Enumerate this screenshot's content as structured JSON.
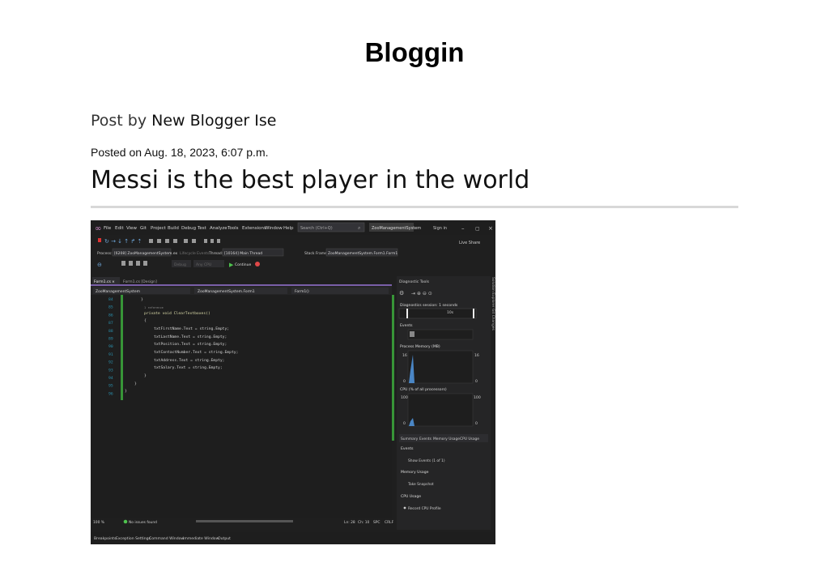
{
  "site": {
    "title": "Bloggin"
  },
  "post": {
    "byline_prefix": "Post by",
    "author": "New Blogger Ise",
    "posted": "Posted on Aug. 18, 2023, 6:07 p.m.",
    "title": "Messi is the best player in the world"
  },
  "screenshot": {
    "menu": [
      "File",
      "Edit",
      "View",
      "Git",
      "Project",
      "Build",
      "Debug",
      "Test",
      "Analyze",
      "Tools",
      "Extensions",
      "Window",
      "Help"
    ],
    "search_placeholder": "Search (Ctrl+Q)",
    "solution_badge": "ZooManagementSystem",
    "sign_in": "Sign in",
    "live_share": "Live Share",
    "process_label": "Process:",
    "process_value": "[6208] ZooManagementSystem.ex",
    "lifecycle_label": "Lifecycle Events",
    "thread_label": "Thread:",
    "thread_value": "[10164] Main Thread",
    "stack_label": "Stack Frame:",
    "stack_value": "ZooManagementSystem.Form1.Form1",
    "continue_label": "Continue",
    "config_value": "Debug",
    "platform_value": "Any CPU",
    "tabs": [
      "Form1.cs",
      "Form1.cs [Design]"
    ],
    "nav_project": "ZooManagementSystem",
    "nav_class": "ZooManagementSystem.Form1",
    "nav_member": "Form1()",
    "line_numbers": [
      "84",
      "85",
      "86",
      "87",
      "88",
      "89",
      "90",
      "91",
      "92",
      "93",
      "94",
      "95",
      "96"
    ],
    "code_ref": "1 reference",
    "code_lines": [
      "}",
      "private void ClearTextboxes()",
      "{",
      "txtFirstName.Text = string.Empty;",
      "txtLastName.Text = string.Empty;",
      "txtPosition.Text = string.Empty;",
      "txtContactNumber.Text = string.Empty;",
      "txtAddress.Text = string.Empty;",
      "txtSalary.Text = string.Empty;",
      "}",
      "}",
      "}"
    ],
    "diag_title": "Diagnostic Tools",
    "diag_session": "Diagnostics session: 1 seconds",
    "diag_10s": "10s",
    "events_label": "Events",
    "memory_label": "Process Memory (MB)",
    "memory_max": "16",
    "memory_min": "0",
    "cpu_label": "CPU (% of all processors)",
    "cpu_max": "100",
    "cpu_min": "0",
    "diag_tabs": [
      "Summary",
      "Events",
      "Memory Usage",
      "CPU Usage"
    ],
    "summary_events": "Events",
    "show_events": "Show Events (1 of 1)",
    "summary_memory": "Memory Usage",
    "take_snapshot": "Take Snapshot",
    "summary_cpu": "CPU Usage",
    "record_cpu": "Record CPU Profile",
    "side_tabs": "Solution Explorer   Git Changes",
    "status_zoom": "100 %",
    "status_issues": "No issues found",
    "status_ln": "Ln: 28",
    "status_ch": "Ch: 10",
    "status_spc": "SPC",
    "status_crlf": "CRLF",
    "bottom_tabs": [
      "Breakpoints",
      "Exception Settings",
      "Command Window",
      "Immediate Window",
      "Output"
    ]
  }
}
